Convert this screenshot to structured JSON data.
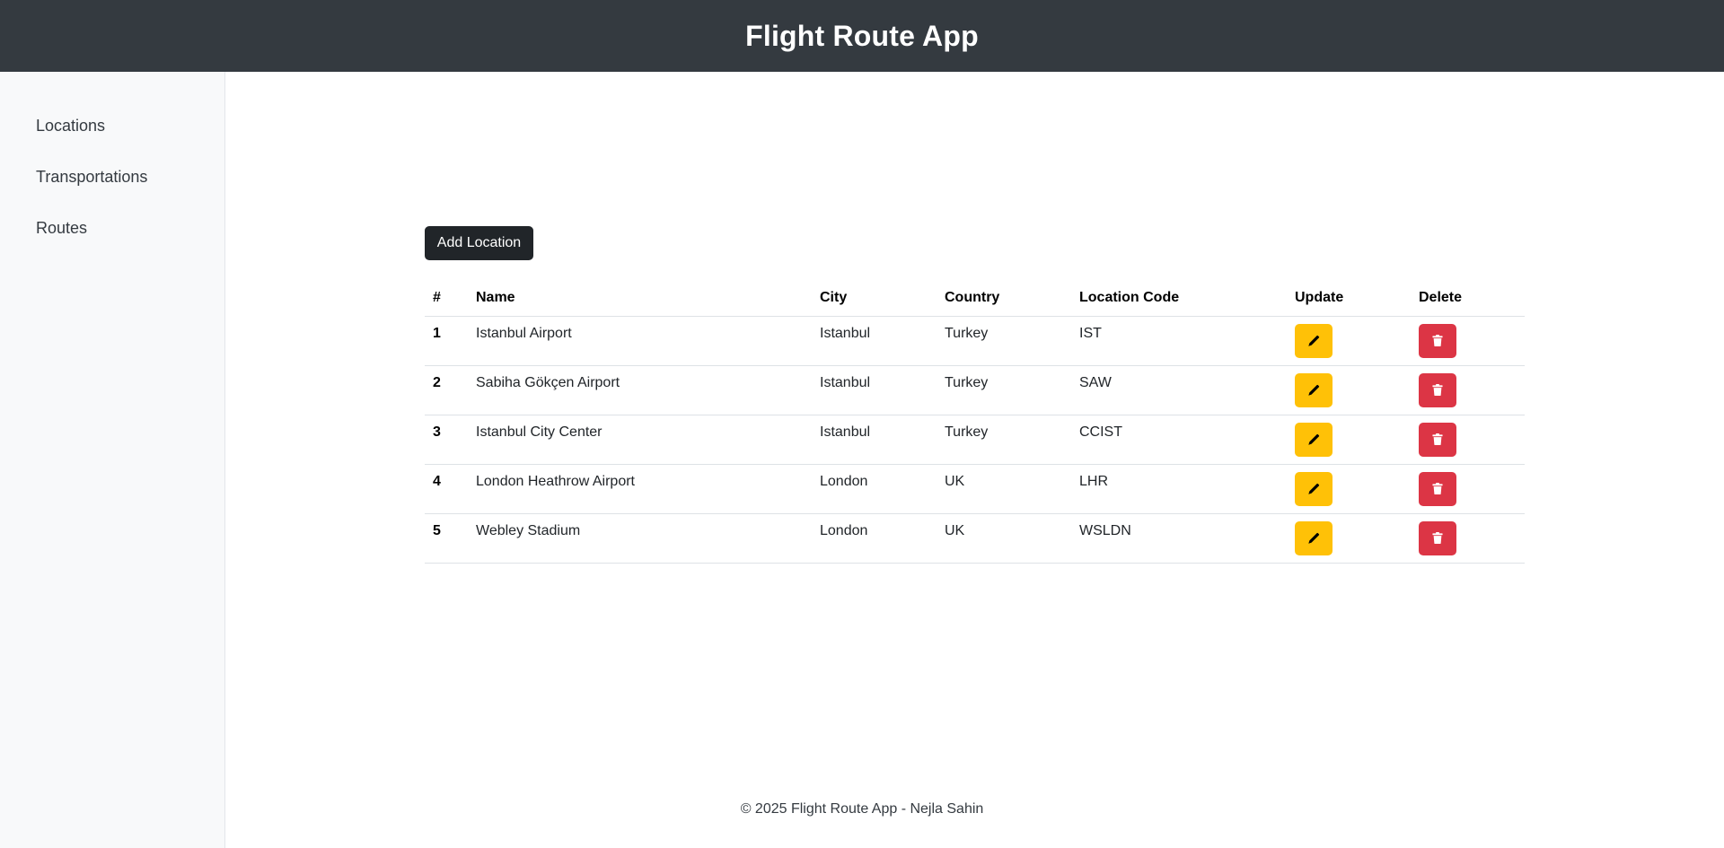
{
  "app": {
    "title": "Flight Route App"
  },
  "sidebar": {
    "items": [
      {
        "label": "Locations"
      },
      {
        "label": "Transportations"
      },
      {
        "label": "Routes"
      }
    ]
  },
  "main": {
    "add_button_label": "Add Location",
    "table": {
      "headers": [
        "#",
        "Name",
        "City",
        "Country",
        "Location Code",
        "Update",
        "Delete"
      ],
      "rows": [
        {
          "index": "1",
          "name": "Istanbul Airport",
          "city": "Istanbul",
          "country": "Turkey",
          "code": "IST"
        },
        {
          "index": "2",
          "name": "Sabiha Gökçen Airport",
          "city": "Istanbul",
          "country": "Turkey",
          "code": "SAW"
        },
        {
          "index": "3",
          "name": "Istanbul City Center",
          "city": "Istanbul",
          "country": "Turkey",
          "code": "CCIST"
        },
        {
          "index": "4",
          "name": "London Heathrow Airport",
          "city": "London",
          "country": "UK",
          "code": "LHR"
        },
        {
          "index": "5",
          "name": "Webley Stadium",
          "city": "London",
          "country": "UK",
          "code": "WSLDN"
        }
      ],
      "update_icon": "pencil-icon",
      "delete_icon": "trash-icon"
    }
  },
  "footer": {
    "text": "© 2025 Flight Route App - Nejla Sahin"
  },
  "colors": {
    "header_bg": "#343a40",
    "sidebar_bg": "#f8f9fa",
    "primary_button": "#212529",
    "update_button": "#ffc107",
    "delete_button": "#dc3545"
  }
}
